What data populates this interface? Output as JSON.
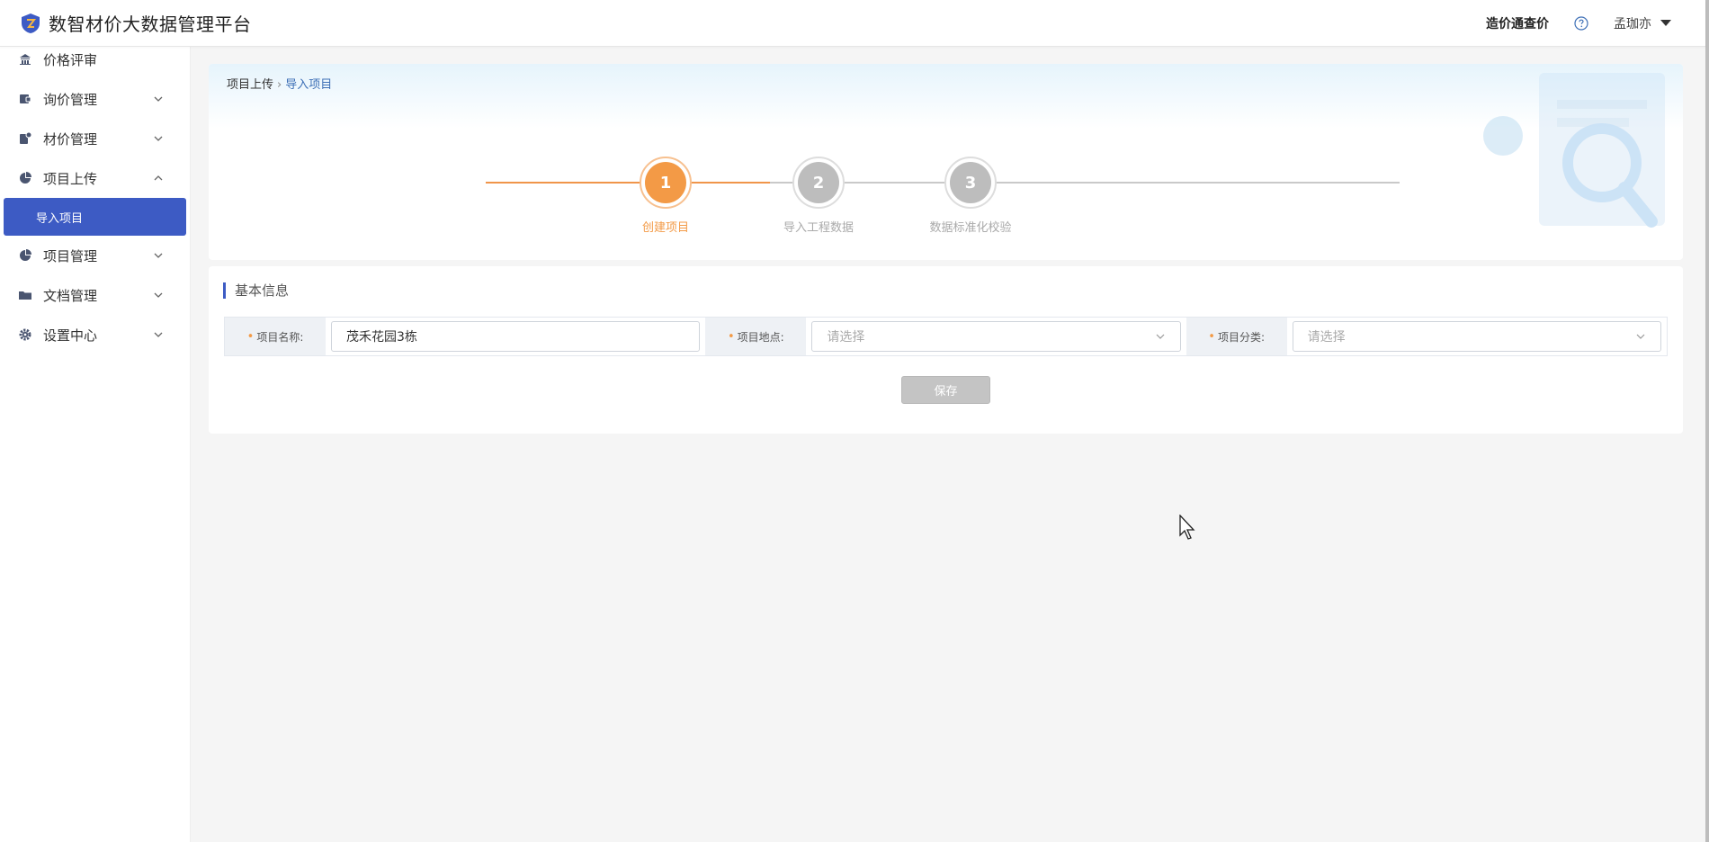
{
  "header": {
    "title": "数智材价大数据管理平台",
    "link_label": "造价通查价",
    "username": "孟珈亦",
    "icons": {
      "logo": "shield-logo",
      "help": "question-circle-icon",
      "caret": "caret-down-icon"
    }
  },
  "sidebar": {
    "items": [
      {
        "label": "价格评审",
        "icon": "bank-icon",
        "has_chevron": false
      },
      {
        "label": "询价管理",
        "icon": "wallet-icon",
        "has_chevron": true
      },
      {
        "label": "材价管理",
        "icon": "doc-gear-icon",
        "has_chevron": true
      },
      {
        "label": "项目上传",
        "icon": "pie-icon",
        "has_chevron": true,
        "expanded": true
      },
      {
        "label": "项目管理",
        "icon": "pie-icon",
        "has_chevron": true
      },
      {
        "label": "文档管理",
        "icon": "folder-icon",
        "has_chevron": true
      },
      {
        "label": "设置中心",
        "icon": "gear-icon",
        "has_chevron": true
      }
    ],
    "subitem_active": "导入项目"
  },
  "breadcrumb": {
    "parent": "项目上传",
    "current": "导入项目"
  },
  "steps": [
    {
      "number": "1",
      "label": "创建项目",
      "active": true
    },
    {
      "number": "2",
      "label": "导入工程数据",
      "active": false
    },
    {
      "number": "3",
      "label": "数据标准化校验",
      "active": false
    }
  ],
  "form": {
    "section_title": "基本信息",
    "fields": [
      {
        "label": "项目名称:",
        "value": "茂禾花园3栋",
        "placeholder": ""
      },
      {
        "label": "项目地点:",
        "value": "",
        "placeholder": "请选择"
      },
      {
        "label": "项目分类:",
        "value": "",
        "placeholder": "请选择"
      }
    ],
    "save_label": "保存"
  },
  "colors": {
    "accent": "#3d5bc4",
    "step_active": "#f39a46",
    "step_inactive": "#bdbdbd"
  }
}
